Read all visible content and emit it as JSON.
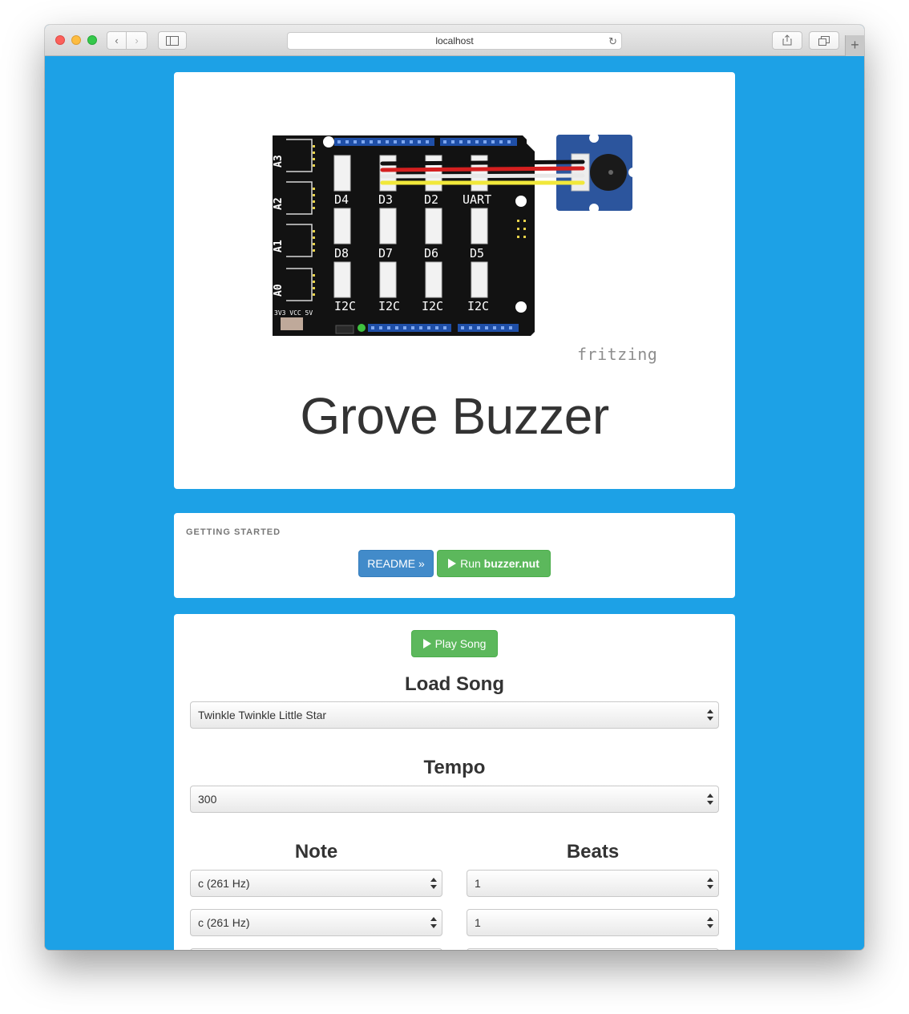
{
  "browser": {
    "url": "localhost"
  },
  "hero": {
    "title": "Grove Buzzer",
    "watermark": "fritzing",
    "board": {
      "analog_labels": [
        "A3",
        "A2",
        "A1",
        "A0"
      ],
      "digital_labels": [
        "D4",
        "D3",
        "D2",
        "UART",
        "D8",
        "D7",
        "D6",
        "D5",
        "I2C",
        "I2C",
        "I2C",
        "I2C"
      ],
      "power_label": "3V3 VCC 5V"
    }
  },
  "getting_started": {
    "heading": "GETTING STARTED",
    "readme_label": "README »",
    "run_label": "Run",
    "run_file": "buzzer.nut"
  },
  "controls": {
    "play_label": "Play Song",
    "load_song_title": "Load Song",
    "song_value": "Twinkle Twinkle Little Star",
    "tempo_title": "Tempo",
    "tempo_value": "300",
    "note_title": "Note",
    "beats_title": "Beats",
    "notes": [
      "c (261 Hz)",
      "c (261 Hz)"
    ],
    "beats": [
      "1",
      "1"
    ]
  }
}
